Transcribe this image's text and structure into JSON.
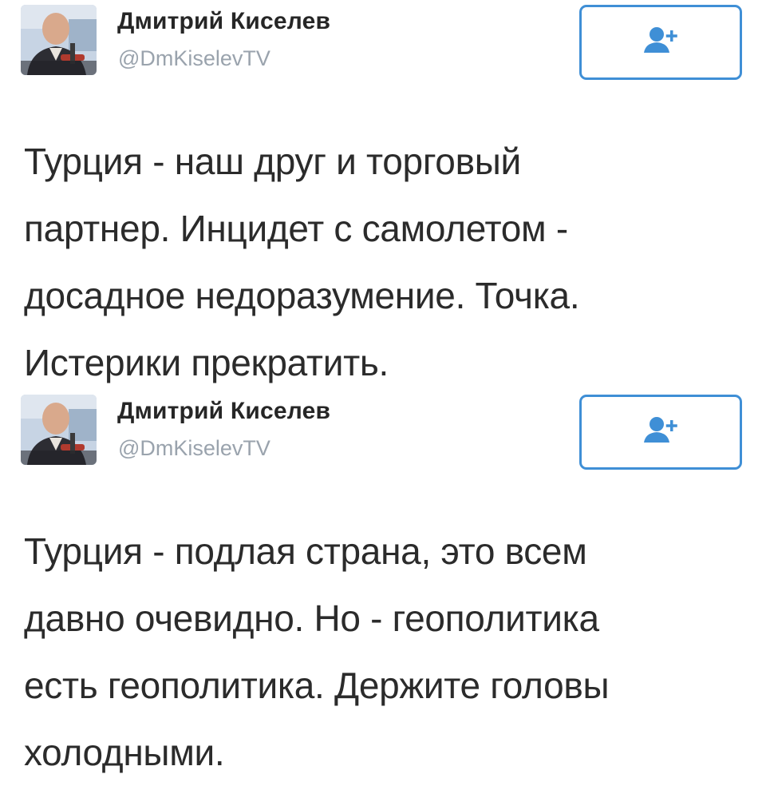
{
  "tweets": [
    {
      "author": {
        "name": "Дмитрий Киселев",
        "handle": "@DmKiselevTV"
      },
      "follow_icon": "add-user-icon",
      "text_lines": [
        "Турция - наш друг и торговый",
        "партнер. Инцидет с самолетом -",
        "досадное недоразумение. Точка.",
        "Истерики прекратить."
      ]
    },
    {
      "author": {
        "name": "Дмитрий Киселев",
        "handle": "@DmKiselevTV"
      },
      "follow_icon": "add-user-icon",
      "text_lines": [
        "Турция - подлая страна, это всем",
        "давно очевидно. Но - геополитика",
        "есть геополитика. Держите головы",
        "холодными."
      ]
    }
  ],
  "colors": {
    "accent": "#3f8fd6",
    "name": "#262626",
    "handle": "#9aa3ad",
    "text": "#2b2b2b"
  }
}
